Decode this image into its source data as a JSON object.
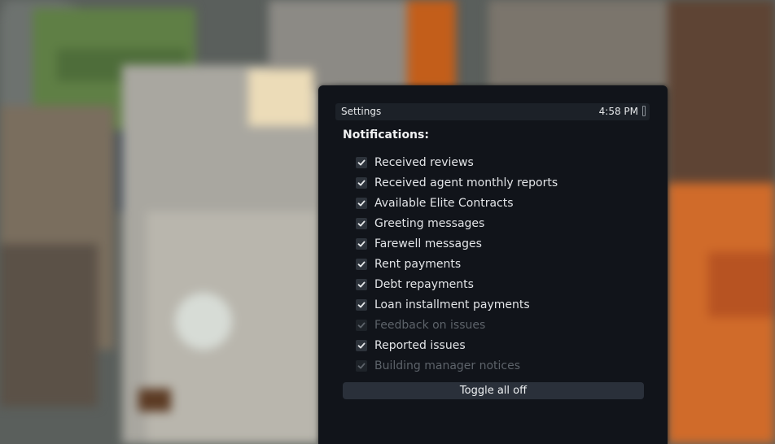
{
  "window": {
    "title": "Settings",
    "clock": "4:58 PM",
    "battery_icon": "battery-icon"
  },
  "notifications": {
    "heading": "Notifications:",
    "items": [
      {
        "label": "Received reviews",
        "checked": true,
        "enabled": true
      },
      {
        "label": "Received agent monthly reports",
        "checked": true,
        "enabled": true
      },
      {
        "label": "Available Elite Contracts",
        "checked": true,
        "enabled": true
      },
      {
        "label": "Greeting messages",
        "checked": true,
        "enabled": true
      },
      {
        "label": "Farewell messages",
        "checked": true,
        "enabled": true
      },
      {
        "label": "Rent payments",
        "checked": true,
        "enabled": true
      },
      {
        "label": "Debt repayments",
        "checked": true,
        "enabled": true
      },
      {
        "label": "Loan installment payments",
        "checked": true,
        "enabled": true
      },
      {
        "label": "Feedback on issues",
        "checked": true,
        "enabled": false
      },
      {
        "label": "Reported issues",
        "checked": true,
        "enabled": true
      },
      {
        "label": "Building manager notices",
        "checked": true,
        "enabled": false
      }
    ],
    "toggle_button_label": "Toggle all off"
  },
  "colors": {
    "panel_bg": "#11141a",
    "titlebar_bg": "#1c2128",
    "text": "#e3e5e8",
    "disabled_text": "#5d636a",
    "button_bg": "#2a303a"
  }
}
